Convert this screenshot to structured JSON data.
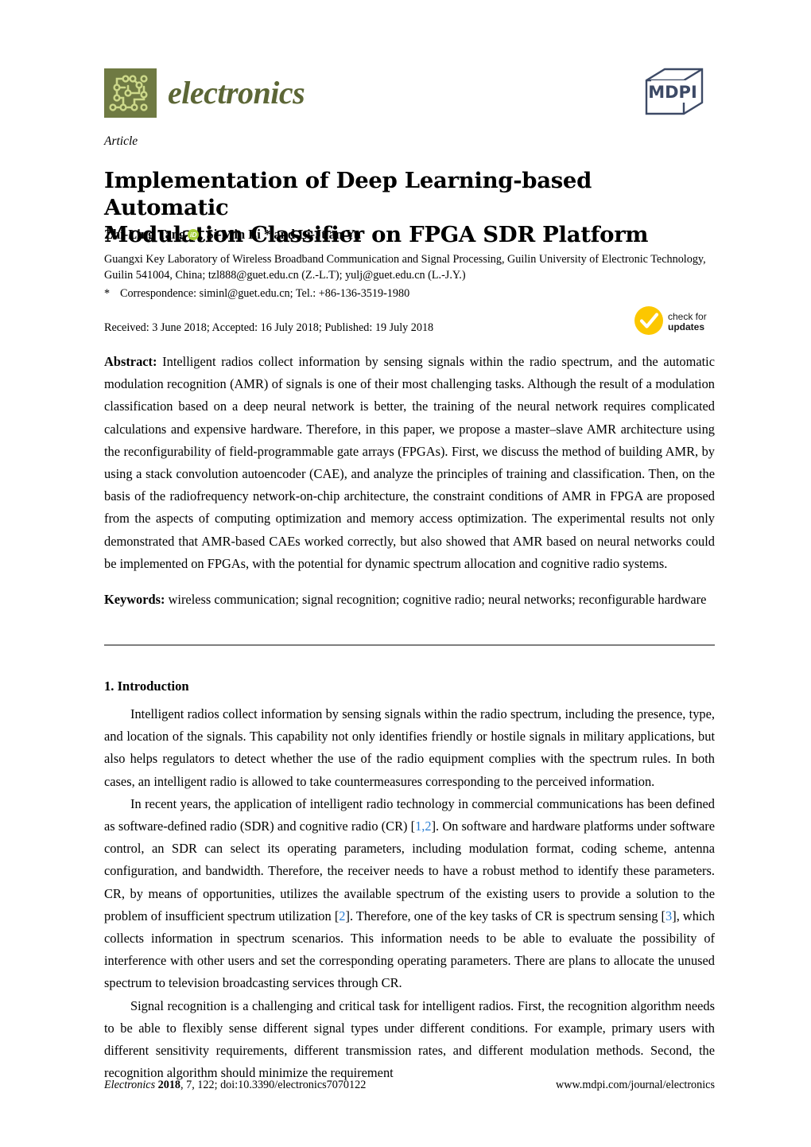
{
  "header": {
    "journal_name": "electronics",
    "journal_logo_color": "#6f7a43",
    "journal_wordmark_color": "#5c6636",
    "publisher_logo": "MDPI",
    "publisher_logo_color": "#3d4a66"
  },
  "article": {
    "type": "Article",
    "title_line_1": "Implementation of Deep Learning-based Automatic",
    "title_line_2": "Modulation Classifier on FPGA SDR Platform",
    "authors_before_orcid": "Zhi-Ling Tang",
    "orcid_glyph": "iD",
    "authors_after_orcid": ", Si-Min Li * and Li-Juan Yu",
    "affiliation": "Guangxi Key Laboratory of Wireless Broadband Communication and Signal Processing, Guilin University of Electronic Technology, Guilin 541004, China; tzl888@guet.edu.cn (Z.-L.T); yulj@guet.edu.cn (L.-J.Y.)",
    "correspondence_marker": "*",
    "correspondence": "Correspondence: siminl@guet.edu.cn; Tel.: +86-136-3519-1980",
    "dates": "Received: 3 June 2018; Accepted: 16 July 2018; Published: 19 July 2018"
  },
  "crossmark": {
    "line1": "check for",
    "line2": "updates",
    "color": "#fcc700"
  },
  "abstract": {
    "label": "Abstract:",
    "text": " Intelligent radios collect information by sensing signals within the radio spectrum, and the automatic modulation recognition (AMR) of signals is one of their most challenging tasks. Although the result of a modulation classification based on a deep neural network is better, the training of the neural network requires complicated calculations and expensive hardware. Therefore, in this paper, we propose a master–slave AMR architecture using the reconfigurability of field-programmable gate arrays (FPGAs). First, we discuss the method of building AMR, by using a stack convolution autoencoder (CAE), and analyze the principles of training and classification. Then, on the basis of the radiofrequency network-on-chip architecture, the constraint conditions of AMR in FPGA are proposed from the aspects of computing optimization and memory access optimization. The experimental results not only demonstrated that AMR-based CAEs worked correctly, but also showed that AMR based on neural networks could be implemented on FPGAs, with the potential for dynamic spectrum allocation and cognitive radio systems."
  },
  "keywords": {
    "label": "Keywords:",
    "text": "  wireless communication; signal recognition; cognitive radio; neural networks; reconfigurable hardware"
  },
  "introduction": {
    "heading": "1. Introduction",
    "paragraph_1": "Intelligent radios collect information by sensing signals within the radio spectrum, including the presence, type, and location of the signals. This capability not only identifies friendly or hostile signals in military applications, but also helps regulators to detect whether the use of the radio equipment complies with the spectrum rules. In both cases, an intelligent radio is allowed to take countermeasures corresponding to the perceived information.",
    "p2_a": "In recent years, the application of intelligent radio technology in commercial communications has been defined as software-defined radio (SDR) and cognitive radio (CR) [",
    "p2_cite1": "1,2",
    "p2_b": "]. On software and hardware platforms under software control, an SDR can select its operating parameters, including modulation format, coding scheme, antenna configuration, and bandwidth. Therefore, the receiver needs to have a robust method to identify these parameters. CR, by means of opportunities, utilizes the available spectrum of the existing users to provide a solution to the problem of insufficient spectrum utilization [",
    "p2_cite2": "2",
    "p2_c": "]. Therefore, one of the key tasks of CR is spectrum sensing [",
    "p2_cite3": "3",
    "p2_d": "], which collects information in spectrum scenarios. This information needs to be able to evaluate the possibility of interference with other users and set the corresponding operating parameters. There are plans to allocate the unused spectrum to television broadcasting services through CR.",
    "paragraph_3": "Signal recognition is a challenging and critical task for intelligent radios. First, the recognition algorithm needs to be able to flexibly sense different signal types under different conditions. For example, primary users with different sensitivity requirements, different transmission rates, and different modulation methods. Second, the recognition algorithm should minimize the requirement",
    "citation_color": "#2b7fd4"
  },
  "footer": {
    "journal_italic": "Electronics",
    "year": "2018",
    "volume_issue": ", 7, 122; doi:10.3390/electronics7070122",
    "website": "www.mdpi.com/journal/electronics"
  }
}
